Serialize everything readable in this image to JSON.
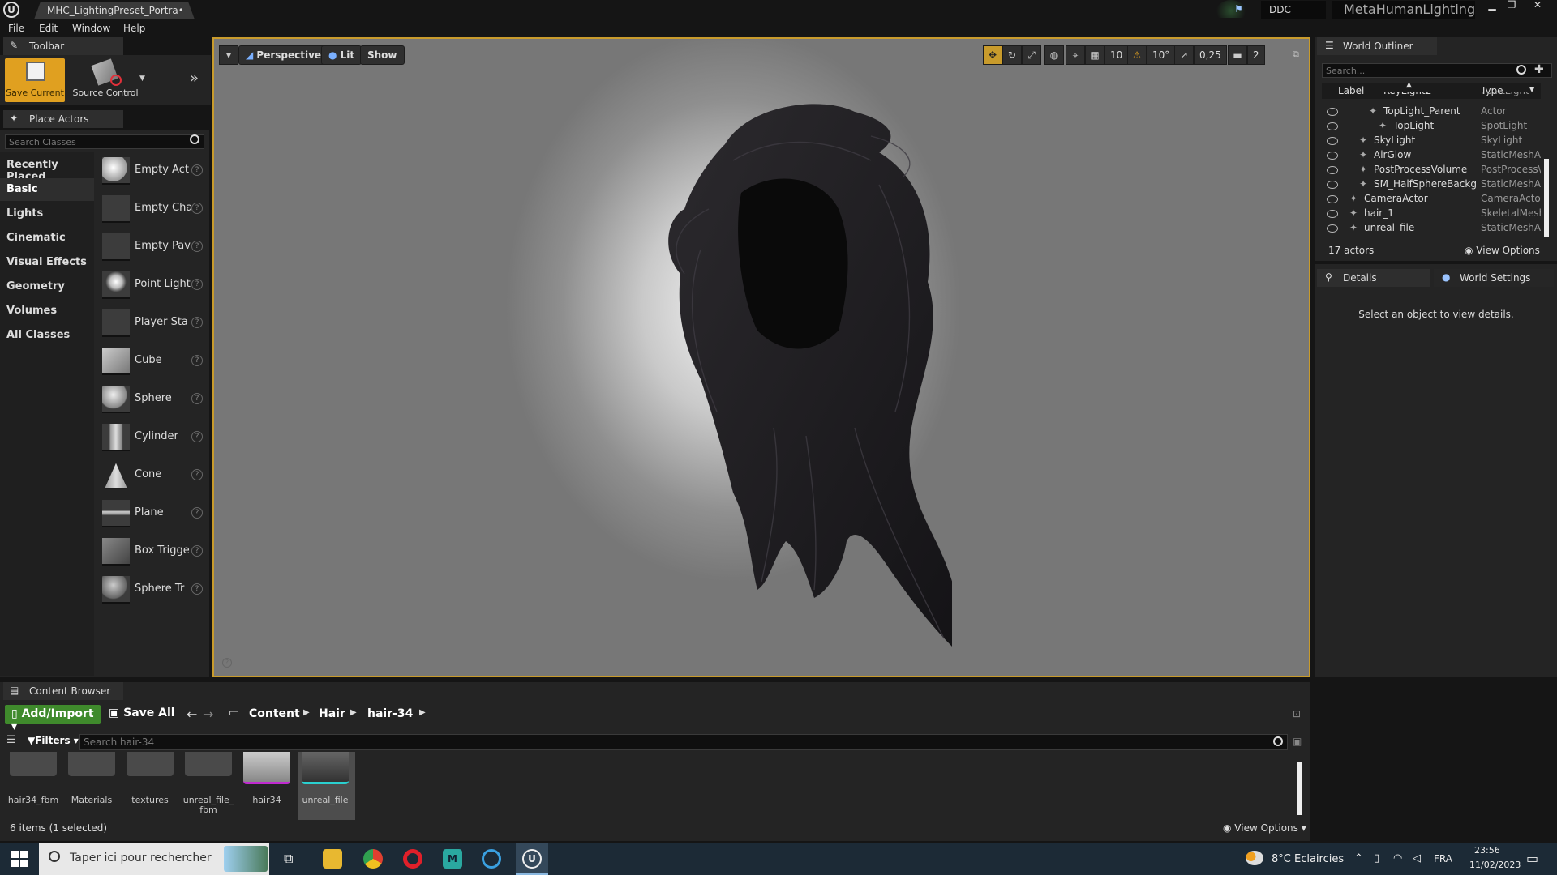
{
  "title_bar": {
    "document_tab": "MHC_LightingPreset_Portra•",
    "ddc_label": "DDC",
    "project_name": "MetaHumanLighting"
  },
  "menu": [
    "File",
    "Edit",
    "Window",
    "Help"
  ],
  "toolbar_panel": {
    "tab_label": "Toolbar",
    "save_current": "Save Current",
    "source_control": "Source Control"
  },
  "place_actors": {
    "tab_label": "Place Actors",
    "search_placeholder": "Search Classes",
    "categories": [
      "Recently Placed",
      "Basic",
      "Lights",
      "Cinematic",
      "Visual Effects",
      "Geometry",
      "Volumes",
      "All Classes"
    ],
    "selected_category": "Basic",
    "items": [
      "Empty Act",
      "Empty Cha",
      "Empty Pav",
      "Point Light",
      "Player Sta",
      "Cube",
      "Sphere",
      "Cylinder",
      "Cone",
      "Plane",
      "Box Trigge",
      "Sphere Tr"
    ]
  },
  "viewport": {
    "perspective_label": "Perspective",
    "lit_label": "Lit",
    "show_label": "Show",
    "grid_snap": "10",
    "rotation_snap": "10°",
    "scale_snap": "0,25",
    "camera_speed": "2"
  },
  "world_outliner": {
    "tab_label": "World Outliner",
    "search_placeholder": "Search...",
    "col_label": "Label",
    "col_type": "Type",
    "rows": [
      {
        "label": "KeyLight2",
        "type": "PointLight",
        "indent": 2
      },
      {
        "label": "TopLight_Parent",
        "type": "Actor",
        "indent": 2
      },
      {
        "label": "TopLight",
        "type": "SpotLight",
        "indent": 3
      },
      {
        "label": "SkyLight",
        "type": "SkyLight",
        "indent": 1
      },
      {
        "label": "AirGlow",
        "type": "StaticMeshAc",
        "indent": 1
      },
      {
        "label": "PostProcessVolume",
        "type": "PostProcess\\",
        "indent": 1
      },
      {
        "label": "SM_HalfSphereBackg",
        "type": "StaticMeshAc",
        "indent": 1
      },
      {
        "label": "CameraActor",
        "type": "CameraActor",
        "indent": 0
      },
      {
        "label": "hair_1",
        "type": "SkeletalMesh",
        "indent": 0
      },
      {
        "label": "unreal_file",
        "type": "StaticMeshAc",
        "indent": 0
      }
    ],
    "actor_count": "17 actors",
    "view_options": "View Options"
  },
  "details": {
    "tab_label": "Details",
    "world_settings_tab": "World Settings",
    "empty_text": "Select an object to view details."
  },
  "content_browser": {
    "tab_label": "Content Browser",
    "add_import": "Add/Import",
    "save_all": "Save All",
    "breadcrumb": [
      "Content",
      "Hair",
      "hair-34"
    ],
    "filters": "Filters",
    "search_placeholder": "Search hair-34",
    "assets": [
      "hair34_fbm",
      "Materials",
      "textures",
      "unreal_file_fbm",
      "hair34",
      "unreal_file"
    ],
    "asset_name_display": [
      "hair34_fbm",
      "Materials",
      "textures",
      "unreal_file_\nfbm",
      "hair34",
      "unreal_file"
    ],
    "status": "6 items (1 selected)",
    "view_options": "View Options"
  },
  "taskbar": {
    "search_text": "Taper ici pour rechercher",
    "weather": "8°C  Eclaircies",
    "language": "FRA",
    "time": "23:56",
    "date": "11/02/2023"
  },
  "colors": {
    "accent_orange": "#c89b2c",
    "add_import_green": "#3f8a2c",
    "selection_blue": "#2a6fb5"
  }
}
